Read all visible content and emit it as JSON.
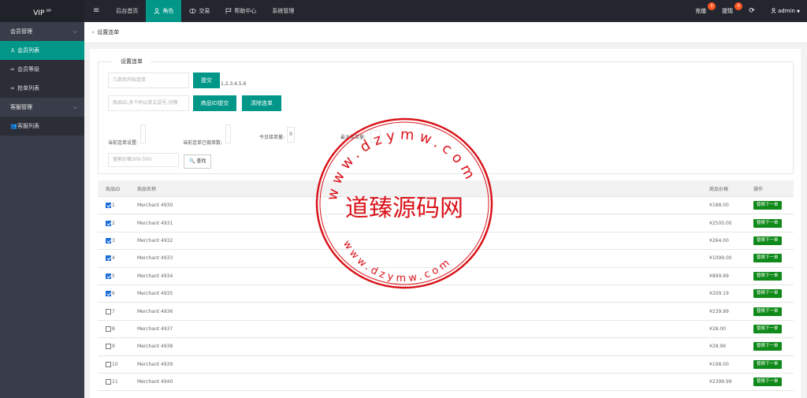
{
  "app": {
    "logo": "VIP",
    "logo_sup": "VIP"
  },
  "topnav": {
    "menu_icon": "≡",
    "items": [
      {
        "label": "后台首页",
        "icon": ""
      },
      {
        "label": "角色",
        "icon": "user-icon"
      },
      {
        "label": "交易",
        "icon": "trade-icon"
      },
      {
        "label": "帮助中心",
        "icon": "flag-icon"
      },
      {
        "label": "系统管理",
        "icon": ""
      }
    ]
  },
  "topright": {
    "recharge": "充值",
    "recharge_badge": "0",
    "withdraw": "提现",
    "withdraw_badge": "0",
    "refresh_icon": "⟳",
    "user": "admin"
  },
  "sidebar": {
    "group1": "会员管理",
    "group1_items": [
      "会员列表",
      "会员等级",
      "抢单列表"
    ],
    "group2": "客服管理",
    "group2_items": [
      "客服列表"
    ]
  },
  "breadcrumb": {
    "sep": "»",
    "title": "设置连单"
  },
  "form": {
    "legend": "设置连单",
    "start_placeholder": "几单后开始连单",
    "submit": "提交",
    "hint": "1,2,3,4,5,6",
    "ids_placeholder": "商品ID,多个时以英文逗号,分隔",
    "submit_ids": "商品ID提交",
    "clear": "清除连单",
    "label_current": "当前连单设置:",
    "label_done": "当前连单已做单数:",
    "label_today": "今日接单量:",
    "today_value": "0",
    "label_max": "最大接单量:",
    "max_value": "40",
    "price_placeholder": "搜索价格300-500",
    "search": "查找"
  },
  "table": {
    "headers": [
      "商品ID",
      "商品名称",
      "商品价格",
      "操作"
    ],
    "rows": [
      {
        "id": "1",
        "name": "Merchant 4930",
        "price": "¥188.00",
        "checked": true
      },
      {
        "id": "2",
        "name": "Merchant 4931",
        "price": "¥2500.00",
        "checked": true
      },
      {
        "id": "3",
        "name": "Merchant 4932",
        "price": "¥264.00",
        "checked": true
      },
      {
        "id": "4",
        "name": "Merchant 4933",
        "price": "¥1099.00",
        "checked": true
      },
      {
        "id": "5",
        "name": "Merchant 4934",
        "price": "¥899.99",
        "checked": true
      },
      {
        "id": "6",
        "name": "Merchant 4935",
        "price": "¥209.19",
        "checked": true
      },
      {
        "id": "7",
        "name": "Merchant 4936",
        "price": "¥239.99",
        "checked": false
      },
      {
        "id": "8",
        "name": "Merchant 4937",
        "price": "¥28.00",
        "checked": false
      },
      {
        "id": "9",
        "name": "Merchant 4938",
        "price": "¥28.99",
        "checked": false
      },
      {
        "id": "10",
        "name": "Merchant 4939",
        "price": "¥198.00",
        "checked": false
      },
      {
        "id": "11",
        "name": "Merchant 4940",
        "price": "¥2399.99",
        "checked": false
      }
    ],
    "op_label": "替换下一单"
  },
  "watermark": {
    "center": "道臻源码网",
    "ring_top": "www.dzymw.com",
    "ring_bottom": "www.dzymw.com",
    "color": "#d9141b"
  }
}
